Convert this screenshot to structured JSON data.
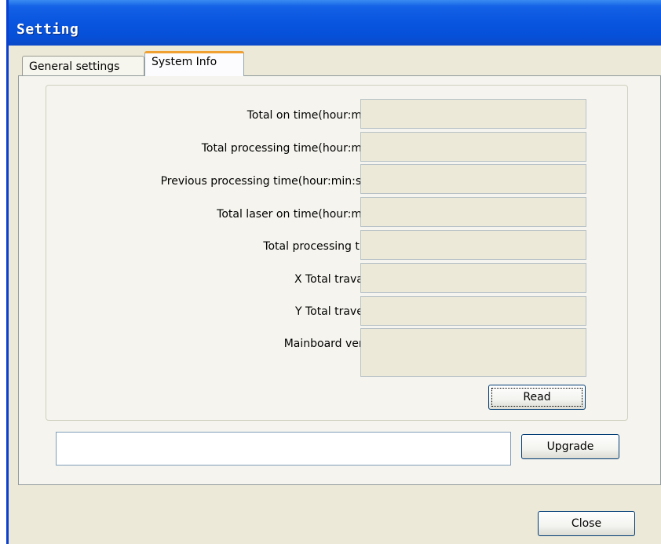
{
  "window": {
    "title": "Setting"
  },
  "tabs": [
    {
      "label": "General settings",
      "selected": false
    },
    {
      "label": "System Info",
      "selected": true
    }
  ],
  "system_info": {
    "fields": [
      {
        "label": "Total on time(hour:min:s):",
        "value": ""
      },
      {
        "label": "Total processing time(hour:min:s):",
        "value": ""
      },
      {
        "label": "Previous processing time(hour:min:s:ms):",
        "value": ""
      },
      {
        "label": "Total laser on time(hour:min:s):",
        "value": ""
      },
      {
        "label": "Total processing times:",
        "value": ""
      },
      {
        "label": "X Total traval(m):",
        "value": ""
      },
      {
        "label": "Y Total travel(m):",
        "value": ""
      },
      {
        "label": "Mainboard version:",
        "value": ""
      }
    ],
    "read_label": "Read"
  },
  "upgrade": {
    "path": "",
    "button_label": "Upgrade"
  },
  "footer": {
    "close_label": "Close"
  },
  "colors": {
    "titlebar": "#0a56e0",
    "dialog_bg": "#ece9d8",
    "selected_tab_accent": "#f0a030"
  }
}
